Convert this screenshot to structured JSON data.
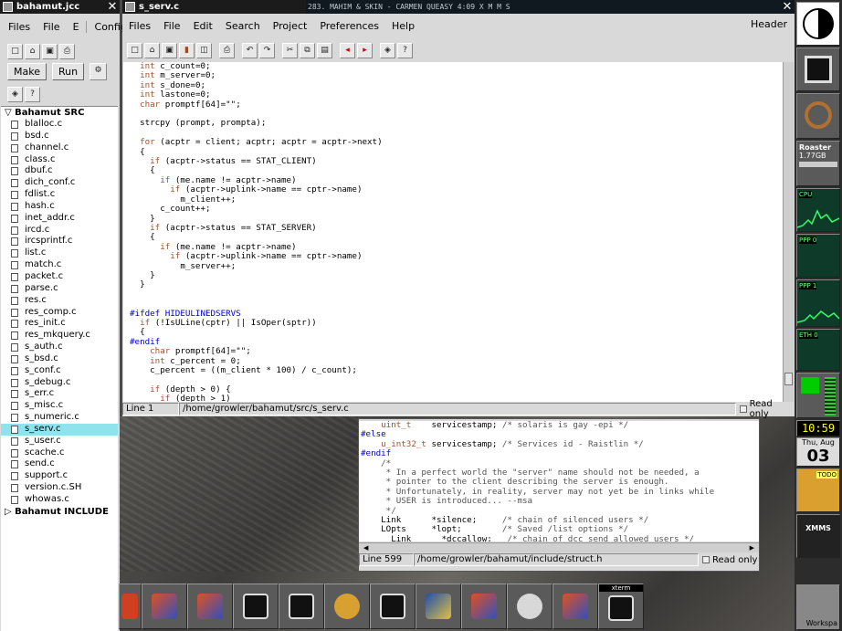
{
  "left_window": {
    "title": "bahamut.jcc",
    "menu": [
      "Files",
      "File",
      "E",
      "Config"
    ],
    "make": "Make",
    "run": "Run"
  },
  "tree": {
    "group1": "Bahamut SRC",
    "files": [
      "blalloc.c",
      "bsd.c",
      "channel.c",
      "class.c",
      "dbuf.c",
      "dich_conf.c",
      "fdlist.c",
      "hash.c",
      "inet_addr.c",
      "ircd.c",
      "ircsprintf.c",
      "list.c",
      "match.c",
      "packet.c",
      "parse.c",
      "res.c",
      "res_comp.c",
      "res_init.c",
      "res_mkquery.c",
      "s_auth.c",
      "s_bsd.c",
      "s_conf.c",
      "s_debug.c",
      "s_err.c",
      "s_misc.c",
      "s_numeric.c",
      "s_serv.c",
      "s_user.c",
      "scache.c",
      "send.c",
      "support.c",
      "version.c.SH",
      "whowas.c"
    ],
    "selected": "s_serv.c",
    "group2": "Bahamut INCLUDE"
  },
  "main_window": {
    "title": "s_serv.c",
    "menu": [
      "Files",
      "File",
      "Edit",
      "Search",
      "Project",
      "Preferences",
      "Help"
    ],
    "header_btn": "Header",
    "status_line": "Line 1",
    "status_path": "/home/growler/bahamut/src/s_serv.c",
    "readonly": "Read only"
  },
  "code1": "  int c_count=0;\n  int m_server=0;\n  int s_done=0;\n  int lastone=0;\n  char promptf[64]=\"\";\n\n  strcpy (prompt, prompta);\n\n  for (acptr = client; acptr; acptr = acptr->next)\n  {\n    if (acptr->status == STAT_CLIENT)\n    {\n      if (me.name != acptr->name)\n        if (acptr->uplink->name == cptr->name)\n          m_client++;\n      c_count++;\n    }\n    if (acptr->status == STAT_SERVER)\n    {\n      if (me.name != acptr->name)\n        if (acptr->uplink->name == cptr->name)\n          m_server++;\n    }\n  }\n\n\n#ifdef HIDEULINEDSERVS\n  if (!IsULine(cptr) || IsOper(sptr))\n  {\n#endif\n    char promptf[64]=\"\";\n    int c_percent = 0;\n    c_percent = ((m_client * 100) / c_count);\n\n    if (depth > 0) {\n      if (depth > 1)",
  "second_window": {
    "status_line": "Line 599",
    "status_path": "/home/growler/bahamut/include/struct.h",
    "readonly": "Read only"
  },
  "code2": "    uint_t    servicestamp; /* solaris is gay -epi */\n#else\n    u_int32_t servicestamp; /* Services id - Raistlin */\n#endif\n    /*\n     * In a perfect world the \"server\" name should not be needed, a\n     * pointer to the client describing the server is enough.\n     * Unfortunately, in reality, server may not yet be in links while\n     * USER is introduced... --msa\n     */\n    Link      *silence;     /* chain of silenced users */\n    LOpts     *lopt;        /* Saved /list options */\n      Link      *dccallow;   /* chain of dcc send allowed users */",
  "xmms_bar": "283. MAHIM & SKIN - CARMEN QUEASY    4:09          X M M S",
  "dock": {
    "roaster": "Roaster",
    "roaster_size": "1.77GB",
    "cpu": "CPU",
    "ppp0": "PPP 0",
    "ppp1": "PPP 1",
    "eth0": "ETH 0",
    "clock": "10:59",
    "date_day": "Thu, Aug",
    "date_num": "03",
    "todo": "TODO",
    "xmms": "XMMS",
    "workspace": "Workspa"
  },
  "taskbar": {
    "xterm": "xterm"
  }
}
